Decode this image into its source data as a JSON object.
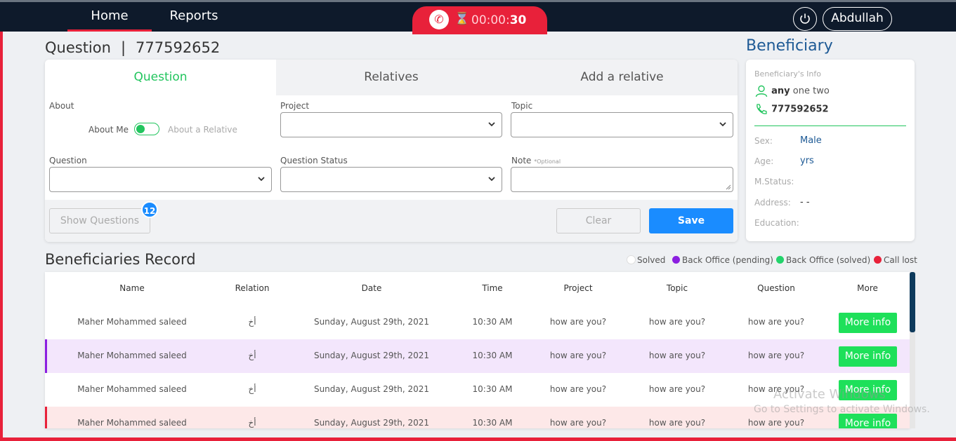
{
  "nav": {
    "home": "Home",
    "reports": "Reports"
  },
  "call": {
    "timer_prefix": "00:00:",
    "timer_seconds": "30"
  },
  "user": {
    "name": "Abdullah"
  },
  "page": {
    "title": "Question",
    "separator": "|",
    "number": "777592652"
  },
  "tabs": [
    "Question",
    "Relatives",
    "Add a relative"
  ],
  "form": {
    "about_label": "About",
    "about_me": "About Me",
    "about_relative": "About a Relative",
    "project_label": "Project",
    "topic_label": "Topic",
    "question_label": "Question",
    "question_status_label": "Question Status",
    "note_label": "Note",
    "note_optional": "*Optional",
    "show_questions": "Show Questions",
    "show_questions_count": "12",
    "clear": "Clear",
    "save": "Save"
  },
  "beneficiary": {
    "title": "Beneficiary",
    "info_header": "Beneficiary's Info",
    "name_bold": "any",
    "name_rest": "one two",
    "phone": "777592652",
    "fields": [
      {
        "label": "Sex:",
        "value": "Male"
      },
      {
        "label": "Age:",
        "value": "yrs"
      },
      {
        "label": "M.Status:",
        "value": ""
      },
      {
        "label": "Address:",
        "value": "- -"
      },
      {
        "label": "Education:",
        "value": ""
      }
    ]
  },
  "records": {
    "title": "Beneficiaries Record",
    "legend": [
      {
        "label": "Solved",
        "color": "#ffffff"
      },
      {
        "label": "Back Office (pending)",
        "color": "#8b1fe0"
      },
      {
        "label": "Back Office (solved)",
        "color": "#22d36b"
      },
      {
        "label": "Call lost",
        "color": "#e8213a"
      }
    ],
    "columns": [
      "Name",
      "Relation",
      "Date",
      "Time",
      "Project",
      "Topic",
      "Question",
      "More"
    ],
    "more_label": "More info",
    "rows": [
      {
        "name": "Maher Mohammed saleed",
        "relation": "أخ",
        "date": "Sunday, August 29th, 2021",
        "time": "10:30 AM",
        "project": "how are you?",
        "topic": "how are you?",
        "question": "how are you?",
        "bg": "#ffffff",
        "accent": ""
      },
      {
        "name": "Maher Mohammed saleed",
        "relation": "أخ",
        "date": "Sunday, August 29th, 2021",
        "time": "10:30 AM",
        "project": "how are you?",
        "topic": "how are you?",
        "question": "how are you?",
        "bg": "#f3e6fc",
        "accent": "#8b1fe0"
      },
      {
        "name": "Maher Mohammed saleed",
        "relation": "أخ",
        "date": "Sunday, August 29th, 2021",
        "time": "10:30 AM",
        "project": "how are you?",
        "topic": "how are you?",
        "question": "how are you?",
        "bg": "#ffffff",
        "accent": ""
      },
      {
        "name": "Maher Mohammed saleed",
        "relation": "أخ",
        "date": "Sunday, August 29th, 2021",
        "time": "10:30 AM",
        "project": "how are you?",
        "topic": "how are you?",
        "question": "how are you?",
        "bg": "#fde8e8",
        "accent": "#e8213a"
      }
    ]
  },
  "watermark": {
    "activate_title": "Activate Windows",
    "activate_sub": "Go to Settings to activate Windows."
  }
}
